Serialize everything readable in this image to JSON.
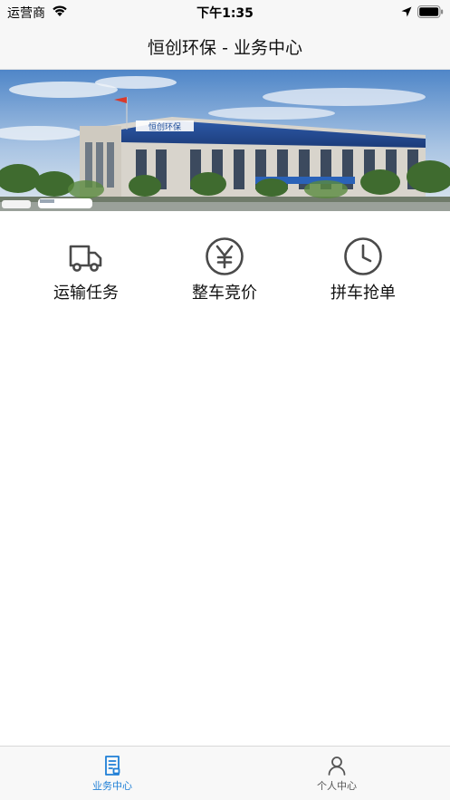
{
  "status_bar": {
    "carrier": "运营商",
    "time": "下午1:35",
    "icons": [
      "wifi-icon",
      "location-arrow-icon",
      "battery-icon"
    ]
  },
  "nav": {
    "title": "恒创环保 - 业务中心"
  },
  "banner": {
    "description_icon": "company-building-photo",
    "sign_text": "恒创环保"
  },
  "functions": [
    {
      "label": "运输任务",
      "icon": "truck-icon"
    },
    {
      "label": "整车竞价",
      "icon": "yen-circle-icon"
    },
    {
      "label": "拼车抢单",
      "icon": "clock-icon"
    }
  ],
  "tab_bar": {
    "tabs": [
      {
        "label": "业务中心",
        "icon": "document-list-icon",
        "active": true
      },
      {
        "label": "个人中心",
        "icon": "person-icon",
        "active": false
      }
    ],
    "active_color": "#1f7fd6",
    "inactive_color": "#666666"
  },
  "colors": {
    "nav_background": "#f7f7f7",
    "icon_gray": "#4a4a4a",
    "accent_blue": "#1f7fd6"
  }
}
